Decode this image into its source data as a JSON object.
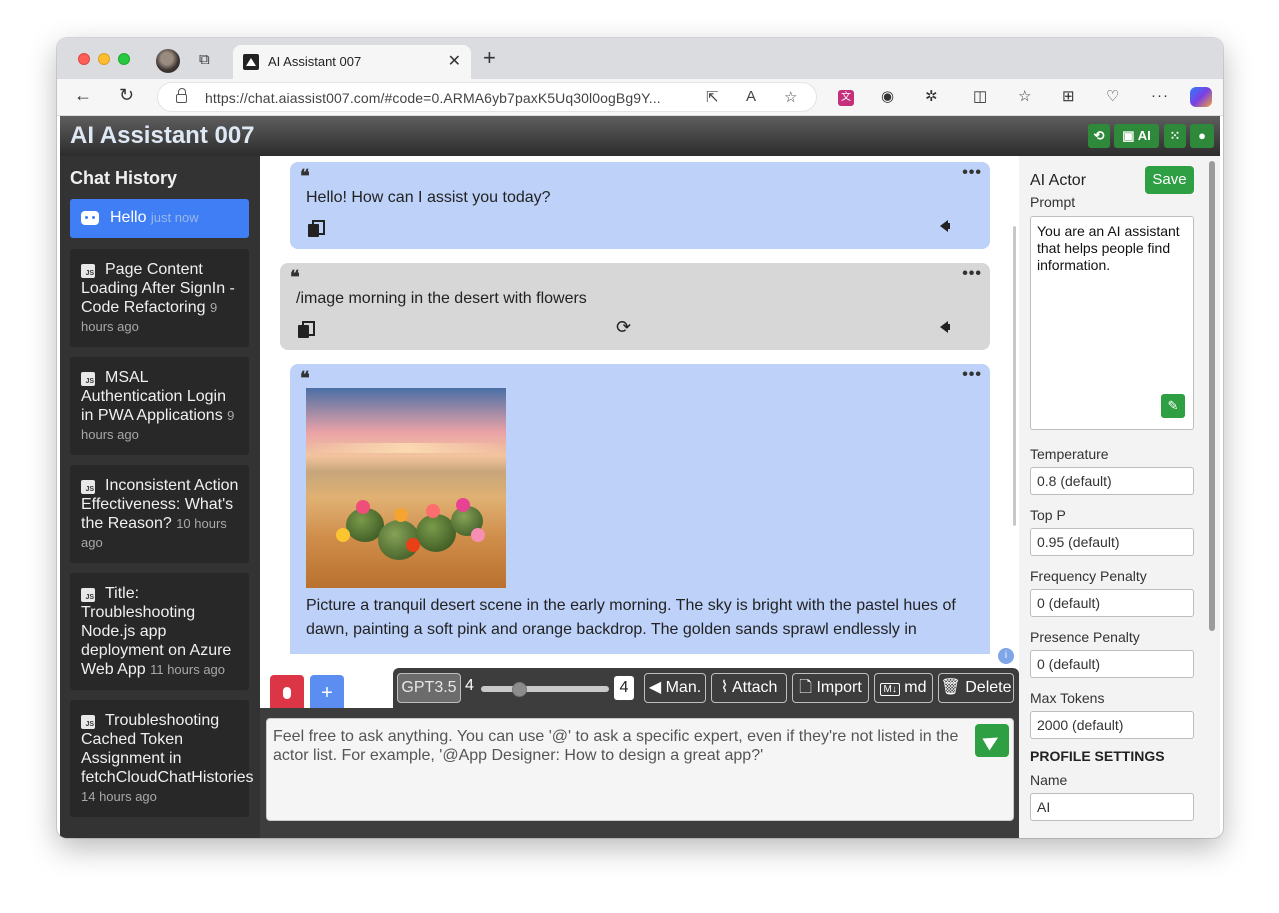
{
  "browser": {
    "tab_title": "AI Assistant 007",
    "url": "https://chat.aiassist007.com/#code=0.ARMA6yb7paxK5Uq30l0ogBg9Y..."
  },
  "app": {
    "title": "AI Assistant 007",
    "header_ai_label": "AI"
  },
  "sidebar": {
    "title": "Chat History",
    "active": {
      "label": "Hello",
      "time": "just now"
    },
    "items": [
      {
        "title": "Page Content Loading After SignIn - Code Refactoring",
        "time": "9 hours ago"
      },
      {
        "title": "MSAL Authentication Login in PWA Applications",
        "time": "9 hours ago"
      },
      {
        "title": "Inconsistent Action Effectiveness: What's the Reason?",
        "time": "10 hours ago"
      },
      {
        "title": "Title: Troubleshooting Node.js app deployment on Azure Web App",
        "time": "11 hours ago"
      },
      {
        "title": "Troubleshooting Cached Token Assignment in fetchCloudChatHistories",
        "time": "14 hours ago"
      }
    ]
  },
  "messages": [
    {
      "role": "assistant",
      "text": "Hello! How can I assist you today?"
    },
    {
      "role": "user",
      "text": "/image morning in the desert with flowers"
    },
    {
      "role": "assistant",
      "text": "Picture a tranquil desert scene in the early morning. The sky is bright with the pastel hues of dawn, painting a soft pink and orange backdrop. The golden sands sprawl endlessly in"
    }
  ],
  "toolbar": {
    "model": "GPT3.5",
    "context_left": "4",
    "context_value": "4",
    "slider_fraction": 0.3,
    "man_label": "Man.",
    "attach_label": "Attach",
    "import_label": "Import",
    "md_label": "md",
    "delete_label": "Delete"
  },
  "input": {
    "placeholder": "Feel free to ask anything. You can use '@' to ask a specific expert, even if they're not listed in the actor list. For example, '@App Designer: How to design a great app?'"
  },
  "right_panel": {
    "title": "AI Actor",
    "save_label": "Save",
    "prompt_label": "Prompt",
    "prompt_value": "You are an AI assistant that helps people find information.",
    "temperature_label": "Temperature",
    "temperature_value": "0.8 (default)",
    "top_p_label": "Top P",
    "top_p_value": "0.95 (default)",
    "freq_label": "Frequency Penalty",
    "freq_value": "0 (default)",
    "presence_label": "Presence Penalty",
    "presence_value": "0 (default)",
    "max_tokens_label": "Max Tokens",
    "max_tokens_value": "2000 (default)",
    "profile_section": "PROFILE SETTINGS",
    "name_label": "Name",
    "name_value": "AI"
  },
  "colors": {
    "assistant_bubble": "#bdd1f9",
    "user_bubble": "#d7d7d7",
    "accent_green": "#2ea043",
    "active_chat": "#3f7ef5",
    "mic_red": "#dc3545"
  }
}
